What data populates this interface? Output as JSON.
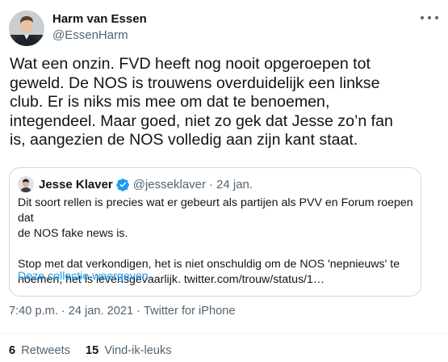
{
  "author": {
    "name": "Harm van Essen",
    "handle": "@EssenHarm"
  },
  "tweet": {
    "text": "Wat een onzin. FVD heeft nog nooit opgeroepen tot\ngeweld. De NOS is trouwens overduidelijk een linkse\nclub. Er is niks mis mee om dat te benoemen,\nintegendeel. Maar goed, niet zo gek dat Jesse zo’n fan\nis, aangezien de NOS volledig aan zijn kant staat."
  },
  "quoted_tweet": {
    "name": "Jesse Klaver",
    "handle": "@jesseklaver",
    "separator": "·",
    "date": "24 jan.",
    "text": "Dit soort rellen is precies wat er gebeurt als partijen als PVV en Forum roepen dat\nde NOS fake news is.\n\nStop met dat verkondigen, het is niet onschuldig om de NOS 'nepnieuws' te\nnoemen, het is levensgevaarlijk. twitter.com/trouw/status/1…",
    "show_thread_label": "Deze collectie weergeven"
  },
  "meta": {
    "time": "7:40 p.m.",
    "separator": "·",
    "date": "24 jan. 2021",
    "source": "Twitter for iPhone"
  },
  "stats": {
    "retweets_count": "6",
    "retweets_label": "Retweets",
    "likes_count": "15",
    "likes_label": "Vind-ik-leuks"
  },
  "colors": {
    "text": "#0f1419",
    "secondary": "#536471",
    "link": "#1d9bf0",
    "border": "#cfd9de"
  },
  "icons": {
    "more": "more-dots-icon",
    "verified": "verified-badge-icon"
  }
}
